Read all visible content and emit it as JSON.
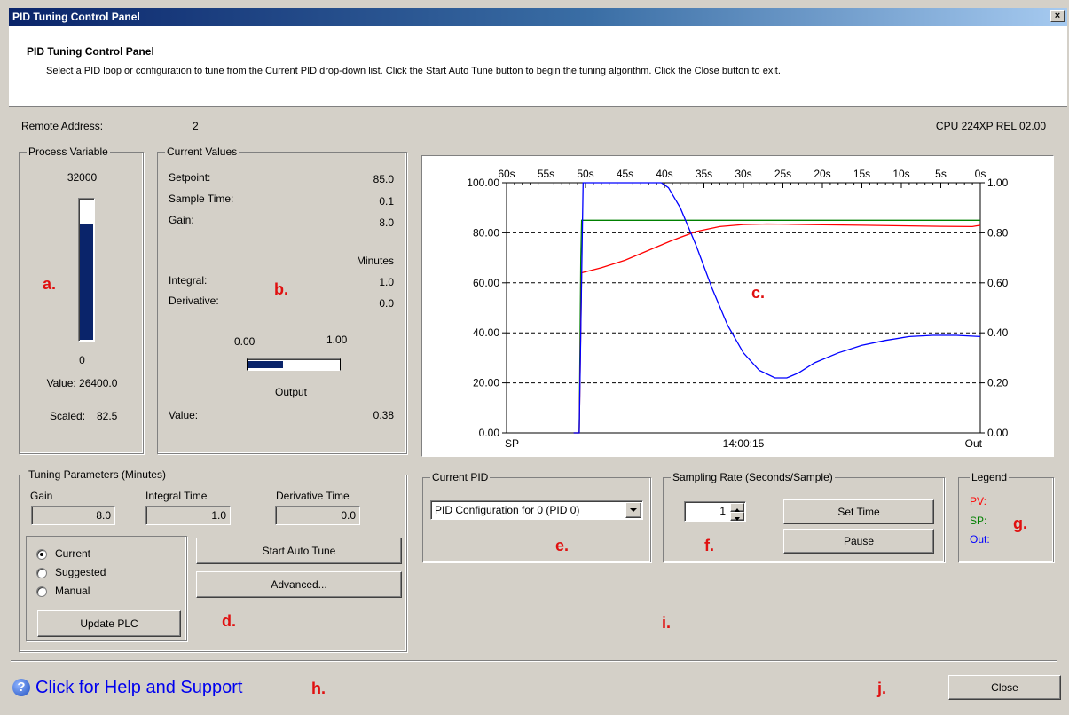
{
  "window": {
    "title": "PID Tuning Control Panel",
    "close_glyph": "×"
  },
  "header": {
    "title": "PID Tuning Control Panel",
    "description": "Select a PID loop or configuration to tune from the Current PID drop-down list.  Click the Start Auto Tune button to begin the tuning algorithm.  Click the Close button to exit."
  },
  "info": {
    "remote_address_label": "Remote Address:",
    "remote_address_value": "2",
    "cpu": "CPU 224XP REL 02.00"
  },
  "process_variable": {
    "label": "Process Variable",
    "max": "32000",
    "min": "0",
    "value_text": "Value: 26400.0",
    "scaled_label": "Scaled:",
    "scaled_value": "82.5",
    "fill_fraction": 0.825
  },
  "current_values": {
    "label": "Current Values",
    "setpoint_label": "Setpoint:",
    "setpoint": "85.0",
    "sample_time_label": "Sample Time:",
    "sample_time": "0.1",
    "gain_label": "Gain:",
    "gain": "8.0",
    "minutes_label": "Minutes",
    "integral_label": "Integral:",
    "integral": "1.0",
    "derivative_label": "Derivative:",
    "derivative": "0.0",
    "output_min": "0.00",
    "output_max": "1.00",
    "output_label": "Output",
    "output_fraction": 0.38,
    "value_label": "Value:",
    "value": "0.38"
  },
  "annotations": {
    "a": "a.",
    "b": "b.",
    "c": "c.",
    "d": "d.",
    "e": "e.",
    "f": "f.",
    "g": "g.",
    "h": "h.",
    "i": "i.",
    "j": "j."
  },
  "tuning": {
    "label": "Tuning Parameters (Minutes)",
    "gain_label": "Gain",
    "gain": "8.0",
    "integral_label": "Integral Time",
    "integral": "1.0",
    "derivative_label": "Derivative Time",
    "derivative": "0.0",
    "radio_current": "Current",
    "radio_suggested": "Suggested",
    "radio_manual": "Manual",
    "selected": "Current",
    "update_plc": "Update PLC",
    "start_auto_tune": "Start Auto Tune",
    "advanced": "Advanced..."
  },
  "current_pid": {
    "label": "Current PID",
    "selected": "PID Configuration for 0 (PID 0)"
  },
  "sampling": {
    "label": "Sampling Rate (Seconds/Sample)",
    "value": "1",
    "set_time": "Set Time",
    "pause": "Pause"
  },
  "legend": {
    "label": "Legend",
    "pv": "PV:",
    "sp": "SP:",
    "out": "Out:",
    "pv_color": "#ff0000",
    "sp_color": "#008000",
    "out_color": "#0000ff"
  },
  "footer": {
    "help": "Click for Help and Support",
    "help_icon": "question-icon",
    "close": "Close"
  },
  "chart_data": {
    "type": "line",
    "top_ticks": [
      "60s",
      "55s",
      "50s",
      "45s",
      "40s",
      "35s",
      "30s",
      "25s",
      "20s",
      "15s",
      "10s",
      "5s",
      "0s"
    ],
    "left_ticks": [
      "100.00",
      "80.00",
      "60.00",
      "40.00",
      "20.00",
      "0.00"
    ],
    "right_ticks": [
      "1.00",
      "0.80",
      "0.60",
      "0.40",
      "0.20",
      "0.00"
    ],
    "bottom_left": "SP",
    "bottom_center": "14:00:15",
    "bottom_right": "Out",
    "ylim": [
      0,
      100
    ],
    "y2lim": [
      0,
      1
    ],
    "xlim": [
      60,
      0
    ],
    "grid": "dashed horizontal",
    "series": [
      {
        "name": "SP",
        "color": "#008000",
        "axis": "left",
        "x": [
          51.5,
          50.8,
          50.6,
          50.5,
          0
        ],
        "y": [
          0,
          0,
          70,
          85,
          85
        ]
      },
      {
        "name": "PV",
        "color": "#ff0000",
        "axis": "left",
        "x": [
          51.5,
          50.8,
          50.5,
          48,
          45,
          42,
          39,
          36,
          33,
          30,
          27,
          24,
          20,
          15,
          10,
          5,
          1,
          0
        ],
        "y": [
          0,
          0,
          64,
          66,
          69,
          73,
          77,
          80.5,
          82.5,
          83.3,
          83.5,
          83.4,
          83.2,
          83,
          82.8,
          82.6,
          82.5,
          83
        ]
      },
      {
        "name": "Out",
        "color": "#0000ff",
        "axis": "right",
        "x": [
          51.5,
          50.8,
          50.3,
          40.4,
          39.5,
          38,
          36,
          34,
          32,
          30,
          28,
          26,
          24.5,
          23,
          21,
          18,
          15,
          12,
          9,
          6,
          3,
          0
        ],
        "y": [
          0,
          0,
          1.0,
          1.0,
          0.98,
          0.9,
          0.75,
          0.58,
          0.43,
          0.32,
          0.25,
          0.22,
          0.22,
          0.24,
          0.28,
          0.32,
          0.35,
          0.37,
          0.385,
          0.39,
          0.39,
          0.385
        ]
      }
    ]
  }
}
